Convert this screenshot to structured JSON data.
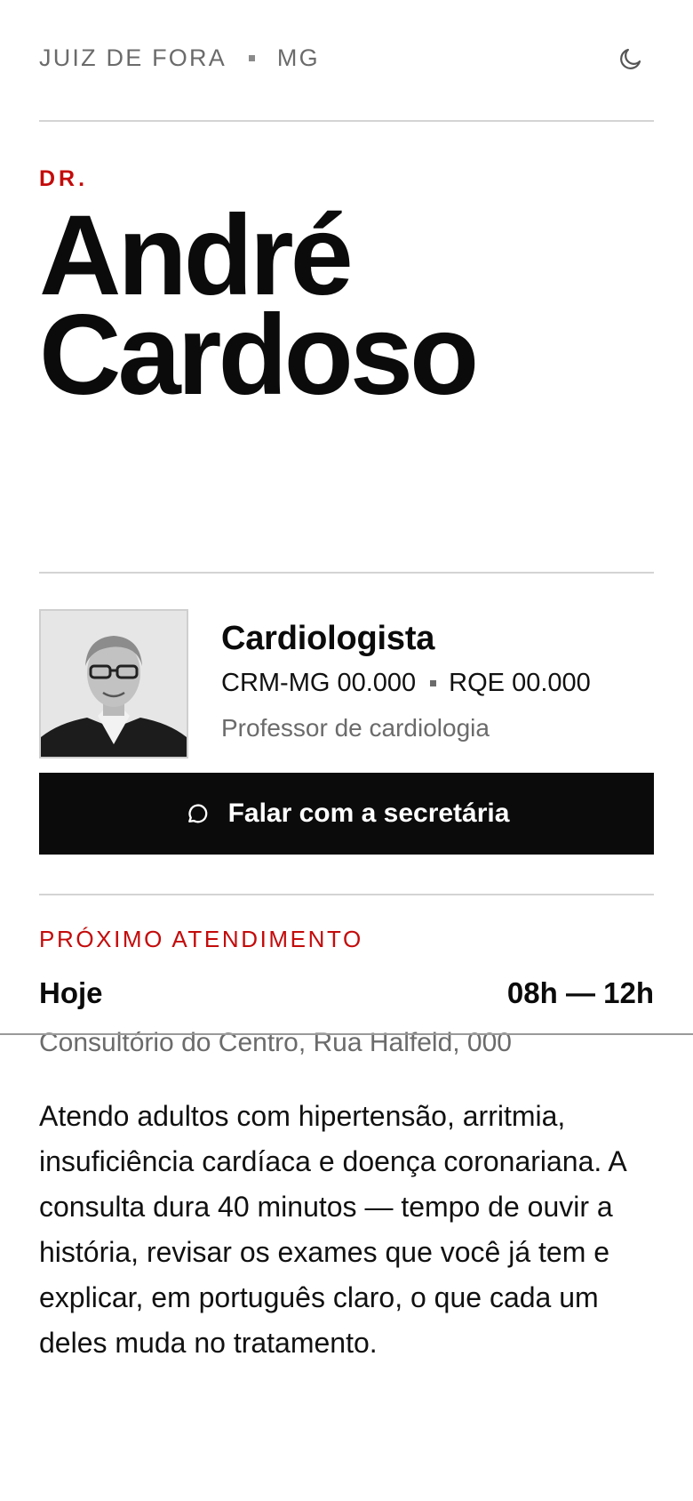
{
  "header": {
    "city": "JUIZ DE FORA",
    "state": "MG",
    "theme_icon": "moon-icon"
  },
  "doctor": {
    "prefix": "DR.",
    "first_name": "André",
    "last_name": "Cardoso",
    "specialty": "Cardiologista",
    "crm": "CRM-MG 00.000",
    "rqe": "RQE 00.000",
    "role": "Professor de cardiologia"
  },
  "cta": {
    "label": "Falar com a secretária",
    "icon": "chat-bubble-icon"
  },
  "next_appointment": {
    "label": "PRÓXIMO ATENDIMENTO",
    "day": "Hoje",
    "hours": "08h — 12h",
    "address": "Consultório do Centro, Rua Halfeld, 000"
  },
  "about": {
    "text": "Atendo adultos com hipertensão, arritmia, insuficiência cardíaca e doença coronariana. A consulta dura 40 minutos — tempo de ouvir a história, revisar os exames que você já tem e explicar, em português claro, o que cada um deles muda no tratamento."
  },
  "colors": {
    "accent": "#c40b0b",
    "ink": "#0b0b0b",
    "muted": "#6b6b6b",
    "rule": "#d4d4d4"
  }
}
